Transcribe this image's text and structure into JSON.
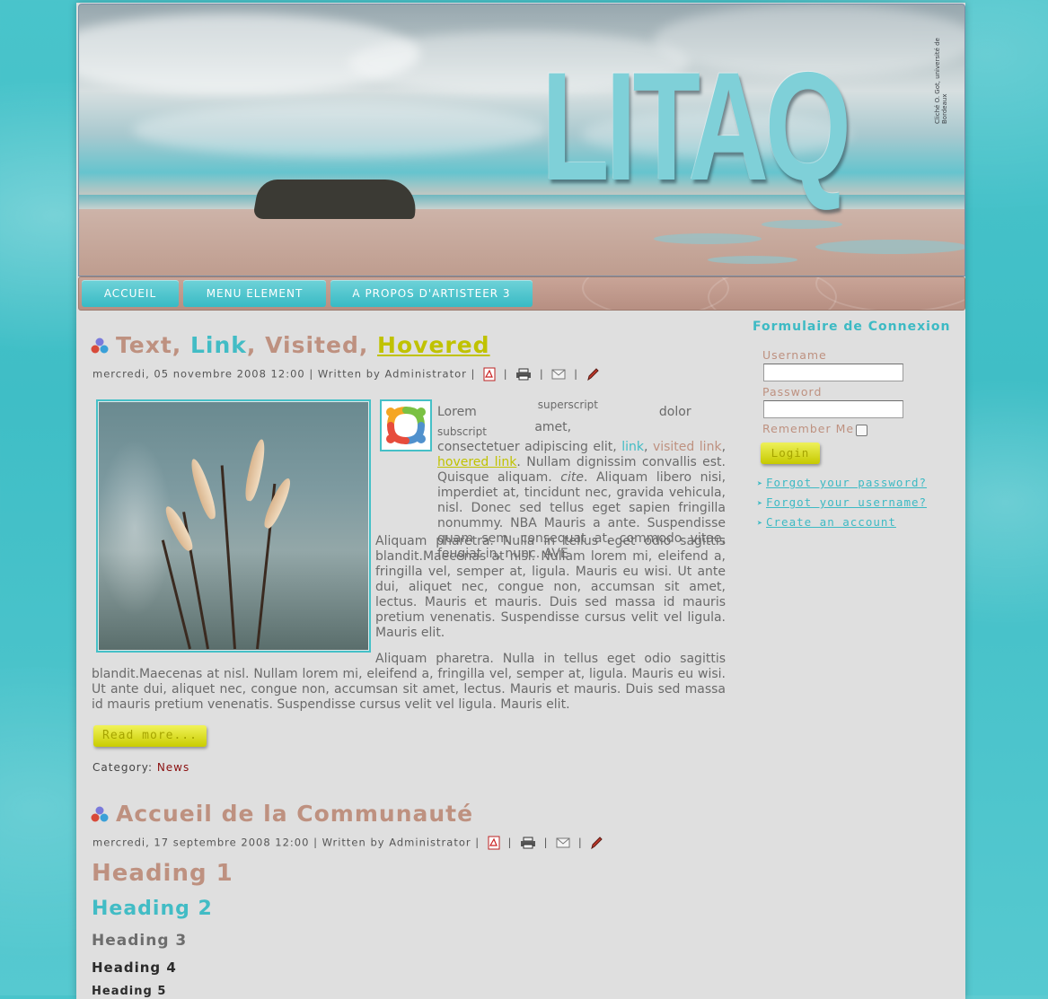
{
  "header": {
    "logo_text": "LITAQ",
    "credit": "Cliché O. Got, université de Bordeaux"
  },
  "nav": {
    "items": [
      {
        "label": "ACCUEIL"
      },
      {
        "label": "MENU ELEMENT"
      },
      {
        "label": "A PROPOS D'ARTISTEER 3"
      }
    ]
  },
  "article1": {
    "title_parts": {
      "text": "Text",
      "link": "Link",
      "visited": "Visited",
      "hovered": "Hovered",
      "sep": ", "
    },
    "meta": "mercredi, 05 novembre 2008 12:00 | Written by Administrator |",
    "body": {
      "lorem": "Lorem",
      "superscript": "superscript",
      "dolor": "dolor",
      "subscript": "subscript",
      "amet": "amet,",
      "p1_a": "consectetuer adipiscing elit,",
      "link": "link",
      "visited_link": "visited link",
      "hovered_link": "hovered link",
      "p1_b": ". Nullam dignissim convallis est. Quisque aliquam.",
      "cite": "cite",
      "p1_c": ". Aliquam libero nisi, imperdiet at, tincidunt nec, gravida vehicula, nisl. Donec sed tellus eget sapien fringilla nonummy. NBA Mauris a ante. Suspendisse quam sem, consequat at, commodo vitae, feugiat in, nunc. AVE",
      "p2": "Aliquam pharetra. Nulla in tellus eget odio sagittis blandit.Maecenas at nisl. Nullam lorem mi, eleifend a, fringilla vel, semper at, ligula. Mauris eu wisi. Ut ante dui, aliquet nec, congue non, accumsan sit amet, lectus. Mauris et mauris. Duis sed massa id mauris pretium venenatis. Suspendisse cursus velit vel ligula. Mauris elit.",
      "p3": "Aliquam pharetra. Nulla in tellus eget odio sagittis blandit.Maecenas at nisl. Nullam lorem mi, eleifend a, fringilla vel, semper at, ligula. Mauris eu wisi. Ut ante dui, aliquet nec, congue non, accumsan sit amet, lectus. Mauris et mauris. Duis sed massa id mauris pretium venenatis. Suspendisse cursus velit vel ligula. Mauris elit."
    },
    "read_more": "Read more...",
    "category_label": "Category:",
    "category_value": "News"
  },
  "article2": {
    "title": "Accueil de la Communauté",
    "meta": "mercredi, 17 septembre 2008 12:00 | Written by Administrator |",
    "headings": {
      "h1": "Heading 1",
      "h2": "Heading 2",
      "h3": "Heading 3",
      "h4": "Heading 4",
      "h5": "Heading 5"
    }
  },
  "sidebar": {
    "title": "Formulaire de Connexion",
    "username_label": "Username",
    "username_value": "",
    "password_label": "Password",
    "password_value": "",
    "remember_label": "Remember Me",
    "remember_checked": false,
    "login_button": "Login",
    "links": [
      {
        "label": "Forgot your password?"
      },
      {
        "label": "Forgot your username?"
      },
      {
        "label": "Create an account"
      }
    ]
  },
  "icons": {
    "pdf": "pdf-icon",
    "print": "print-icon",
    "email": "email-icon",
    "edit": "edit-pencil-icon",
    "article": "article-bullet-icon",
    "joomla": "joomla-logo-icon"
  },
  "colors": {
    "accent_teal": "#42bcc5",
    "accent_rose": "#be9180",
    "accent_yellow": "#c0c200",
    "category": "#8a1010"
  }
}
